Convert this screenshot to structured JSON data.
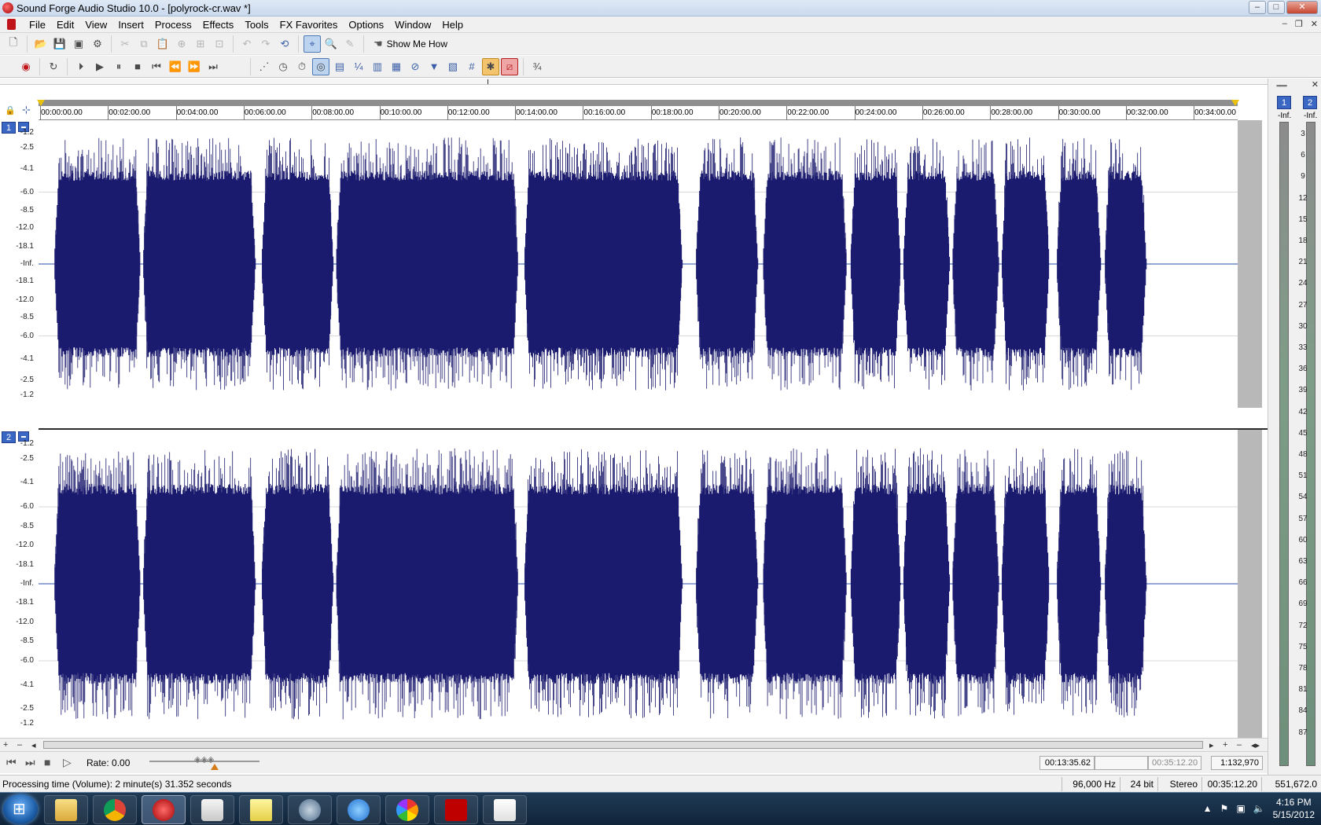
{
  "window": {
    "title": "Sound Forge Audio Studio 10.0 - [polyrock-cr.wav *]",
    "controls": [
      "–",
      "□",
      "✕"
    ]
  },
  "menu": {
    "items": [
      "File",
      "Edit",
      "View",
      "Insert",
      "Process",
      "Effects",
      "Tools",
      "FX Favorites",
      "Options",
      "Window",
      "Help"
    ],
    "mdi_controls": [
      "–",
      "❐",
      "✕"
    ]
  },
  "toolbar": {
    "show_me_how": "Show Me How"
  },
  "ruler": {
    "labels": [
      "00:00:00.00",
      "00:02:00.00",
      "00:04:00.00",
      "00:06:00.00",
      "00:08:00.00",
      "00:10:00.00",
      "00:12:00.00",
      "00:14:00.00",
      "00:16:00.00",
      "00:18:00.00",
      "00:20:00.00",
      "00:22:00.00",
      "00:24:00.00",
      "00:26:00.00",
      "00:28:00.00",
      "00:30:00.00",
      "00:32:00.00",
      "00:34:00.00"
    ]
  },
  "channels": [
    {
      "number": "1",
      "db_labels": [
        "-1.2",
        "-2.5",
        "-4.1",
        "-6.0",
        "-8.5",
        "-12.0",
        "-18.1",
        "-Inf.",
        "-18.1",
        "-12.0",
        "-8.5",
        "-6.0",
        "-4.1",
        "-2.5",
        "-1.2"
      ]
    },
    {
      "number": "2",
      "db_labels": [
        "-1.2",
        "-2.5",
        "-4.1",
        "-6.0",
        "-8.5",
        "-12.0",
        "-18.1",
        "-Inf.",
        "-18.1",
        "-12.0",
        "-8.5",
        "-6.0",
        "-4.1",
        "-2.5",
        "-1.2"
      ]
    }
  ],
  "waveform": {
    "color": "#1a1a6e",
    "center_line_color": "#2a4bb3"
  },
  "transport": {
    "rate_label": "Rate: 0.00",
    "cursor_position": "00:13:35.62",
    "selection_length": "",
    "file_length": "00:35:12.20",
    "zoom_ratio": "1:132,970"
  },
  "status": {
    "message": "Processing time (Volume): 2 minute(s) 31.352 seconds",
    "sample_rate": "96,000 Hz",
    "bit_depth": "24 bit",
    "channels": "Stereo",
    "length": "00:35:12.20",
    "disk_space": "551,672.0 MB"
  },
  "meters": {
    "channels": [
      "1",
      "2"
    ],
    "peaks": [
      "-Inf.",
      "-Inf."
    ],
    "scale": [
      "3",
      "6",
      "9",
      "12",
      "15",
      "18",
      "21",
      "24",
      "27",
      "30",
      "33",
      "36",
      "39",
      "42",
      "45",
      "48",
      "51",
      "54",
      "57",
      "60",
      "63",
      "66",
      "69",
      "72",
      "75",
      "78",
      "81",
      "84",
      "87"
    ]
  },
  "taskbar": {
    "apps": [
      "windows-explorer",
      "google-chrome",
      "sound-forge",
      "todo-app",
      "sticky-notes",
      "steam",
      "itunes",
      "picasa",
      "filezilla",
      "java"
    ],
    "time": "4:16 PM",
    "date": "5/15/2012"
  }
}
